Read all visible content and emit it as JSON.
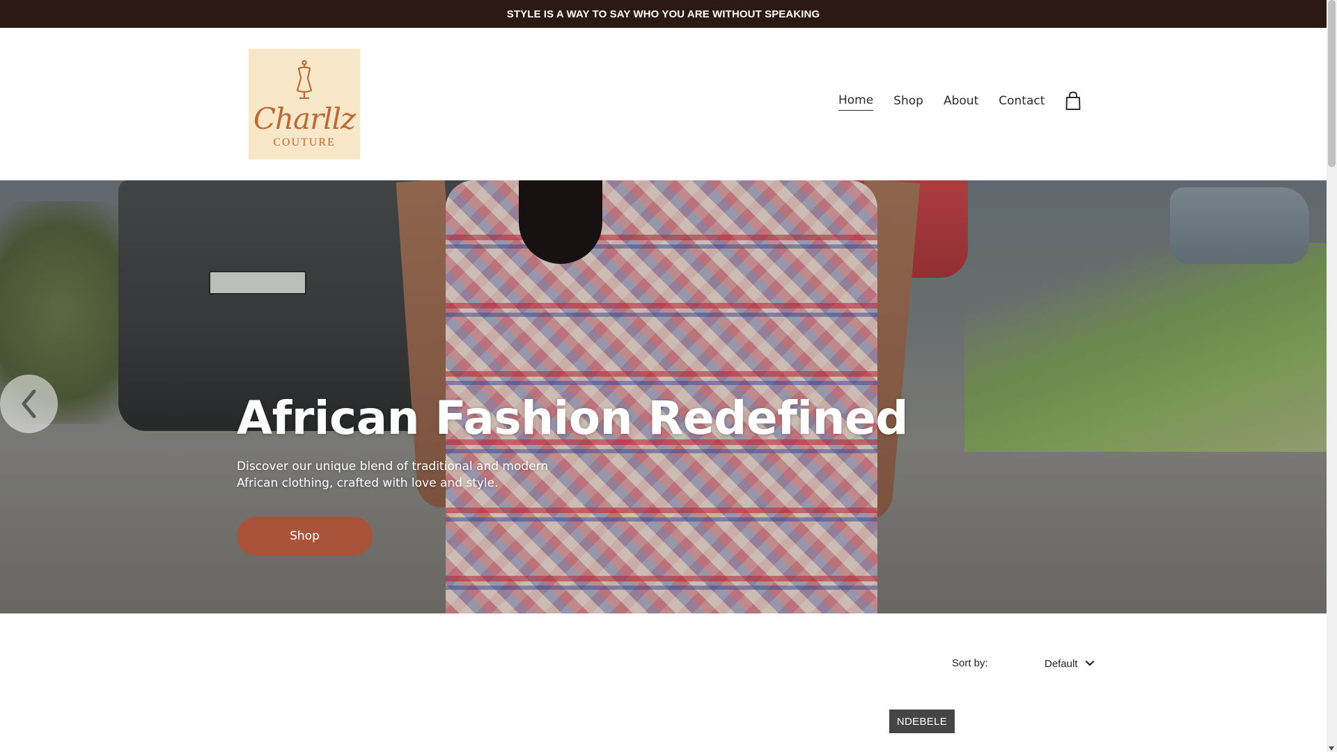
{
  "announcement": {
    "text": "STYLE IS A WAY TO SAY WHO YOU ARE WITHOUT SPEAKING"
  },
  "logo": {
    "name": "Charllz",
    "sub": "COUTURE"
  },
  "nav": {
    "items": [
      {
        "label": "Home",
        "active": true
      },
      {
        "label": "Shop",
        "active": false
      },
      {
        "label": "About",
        "active": false
      },
      {
        "label": "Contact",
        "active": false
      }
    ],
    "cart_icon": "shopping-bag-icon"
  },
  "hero": {
    "title": "African Fashion Redefined",
    "description": "Discover our unique blend of traditional and modern African clothing, crafted with love and style.",
    "button_label": "Shop",
    "prev_icon": "chevron-left-icon"
  },
  "sort": {
    "label": "Sort by:",
    "selected": "Default",
    "icon": "chevron-down-icon"
  },
  "category_tag": {
    "label": "NDEBELE"
  },
  "colors": {
    "announcement_bg": "#2b1a13",
    "accent_button": "#a9543a",
    "logo_bg": "#f9e7c9",
    "logo_text": "#b96a36",
    "tag_bg": "#454545"
  }
}
